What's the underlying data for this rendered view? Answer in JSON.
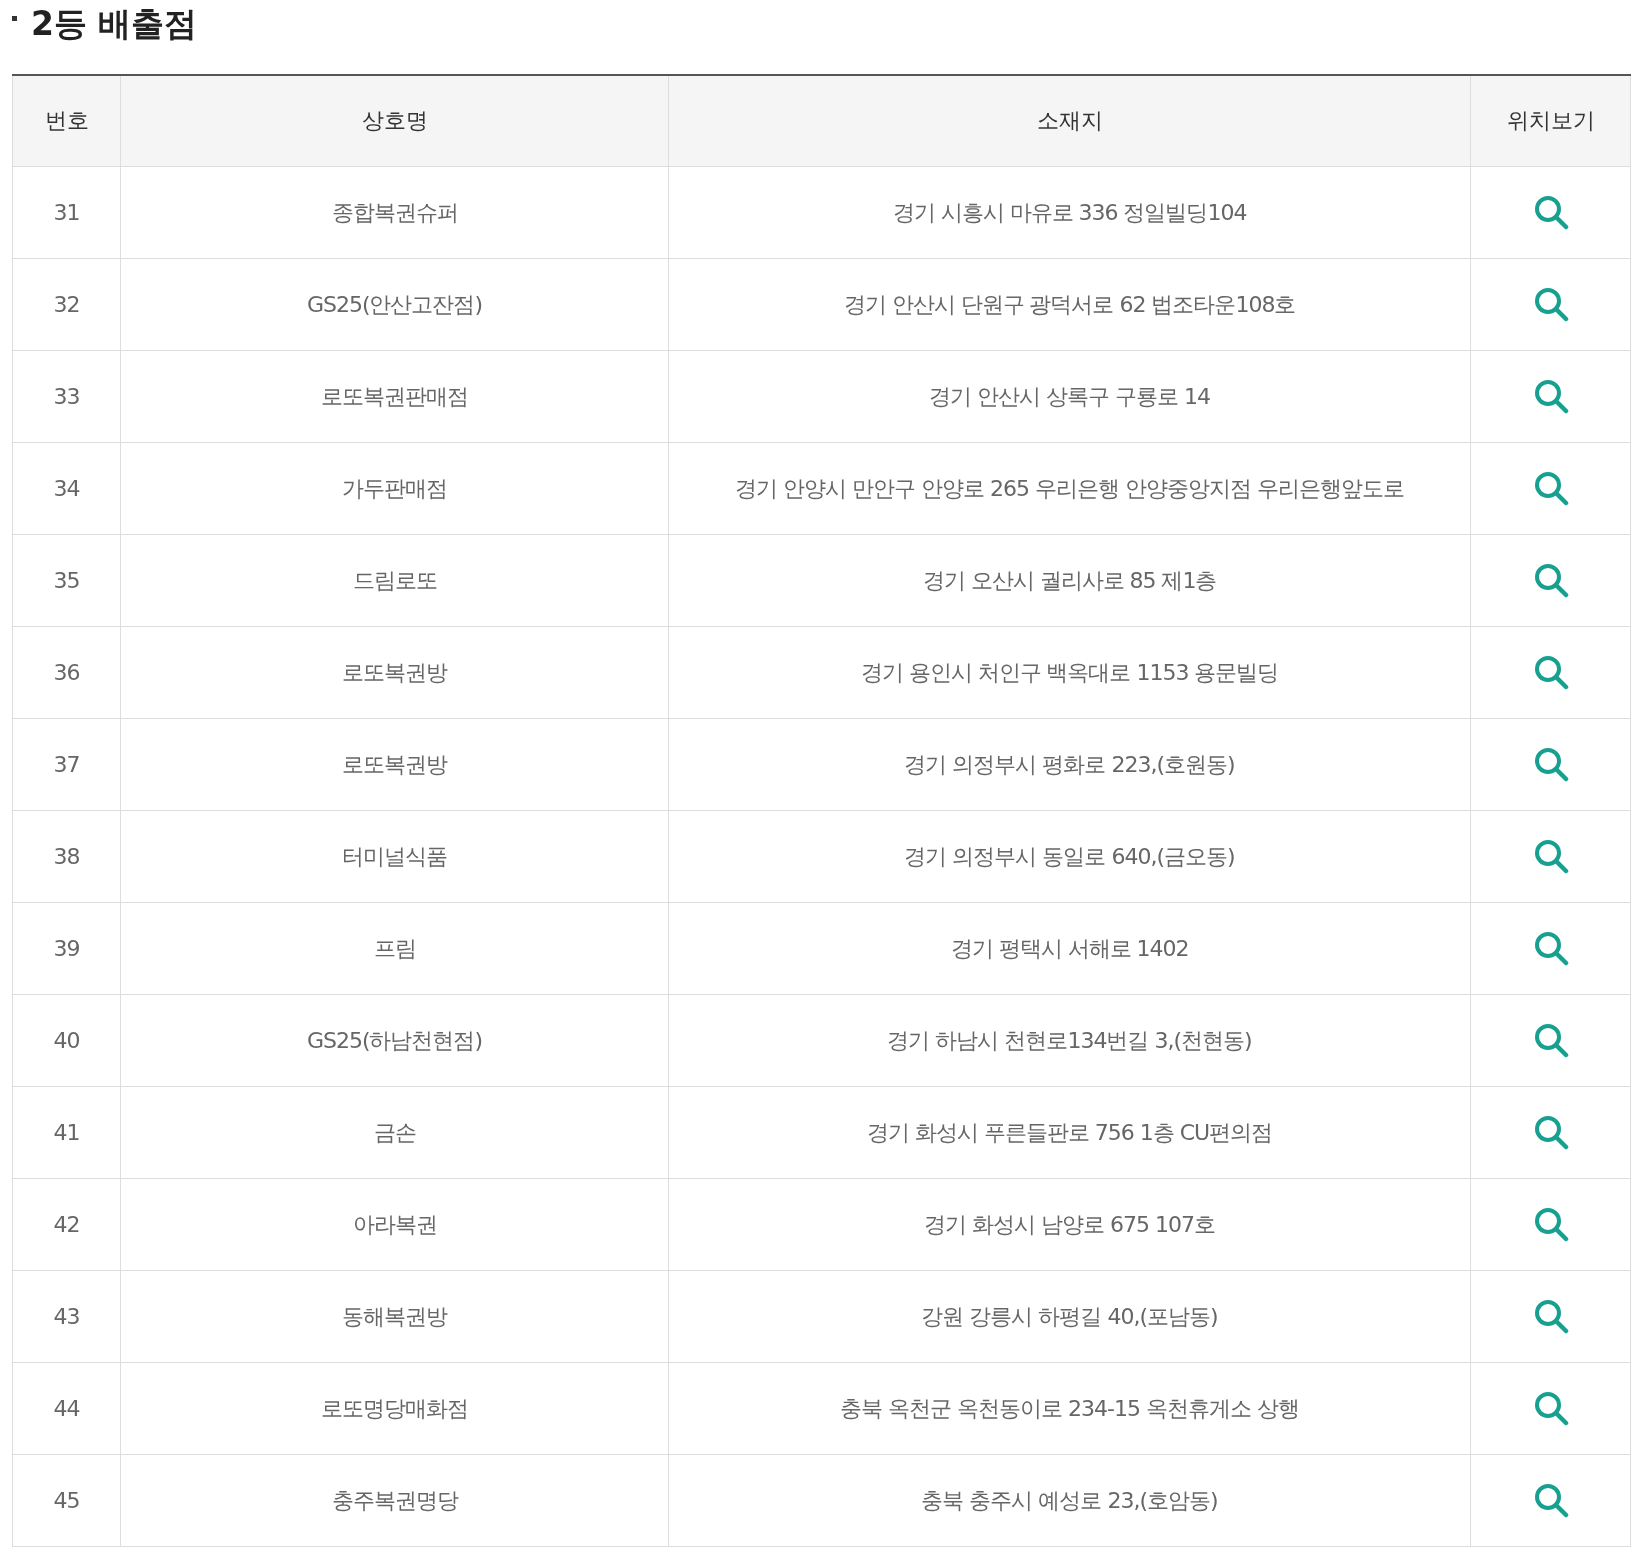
{
  "title": "2등 배출점",
  "table": {
    "columns": [
      "번호",
      "상호명",
      "소재지",
      "위치보기"
    ],
    "rows": [
      {
        "number": "31",
        "name": "종합복권슈퍼",
        "address": "경기 시흥시 마유로 336 정일빌딩104"
      },
      {
        "number": "32",
        "name": "GS25(안산고잔점)",
        "address": "경기 안산시 단원구 광덕서로 62 법조타운108호"
      },
      {
        "number": "33",
        "name": "로또복권판매점",
        "address": "경기 안산시 상록구 구룡로 14"
      },
      {
        "number": "34",
        "name": "가두판매점",
        "address": "경기 안양시 만안구 안양로 265 우리은행 안양중앙지점 우리은행앞도로"
      },
      {
        "number": "35",
        "name": "드림로또",
        "address": "경기 오산시 궐리사로 85 제1층"
      },
      {
        "number": "36",
        "name": "로또복권방",
        "address": "경기 용인시 처인구 백옥대로 1153 용문빌딩"
      },
      {
        "number": "37",
        "name": "로또복권방",
        "address": "경기 의정부시 평화로 223,(호원동)"
      },
      {
        "number": "38",
        "name": "터미널식품",
        "address": "경기 의정부시 동일로 640,(금오동)"
      },
      {
        "number": "39",
        "name": "프림",
        "address": "경기 평택시 서해로 1402"
      },
      {
        "number": "40",
        "name": "GS25(하남천현점)",
        "address": "경기 하남시 천현로134번길 3,(천현동)"
      },
      {
        "number": "41",
        "name": "금손",
        "address": "경기 화성시 푸른들판로 756 1층 CU편의점"
      },
      {
        "number": "42",
        "name": "아라복권",
        "address": "경기 화성시 남양로 675 107호"
      },
      {
        "number": "43",
        "name": "동해복권방",
        "address": "강원 강릉시 하평길 40,(포남동)"
      },
      {
        "number": "44",
        "name": "로또명당매화점",
        "address": "충북 옥천군 옥천동이로 234-15 옥천휴게소 상행"
      },
      {
        "number": "45",
        "name": "충주복권명당",
        "address": "충북 충주시 예성로 23,(호암동)"
      }
    ]
  }
}
